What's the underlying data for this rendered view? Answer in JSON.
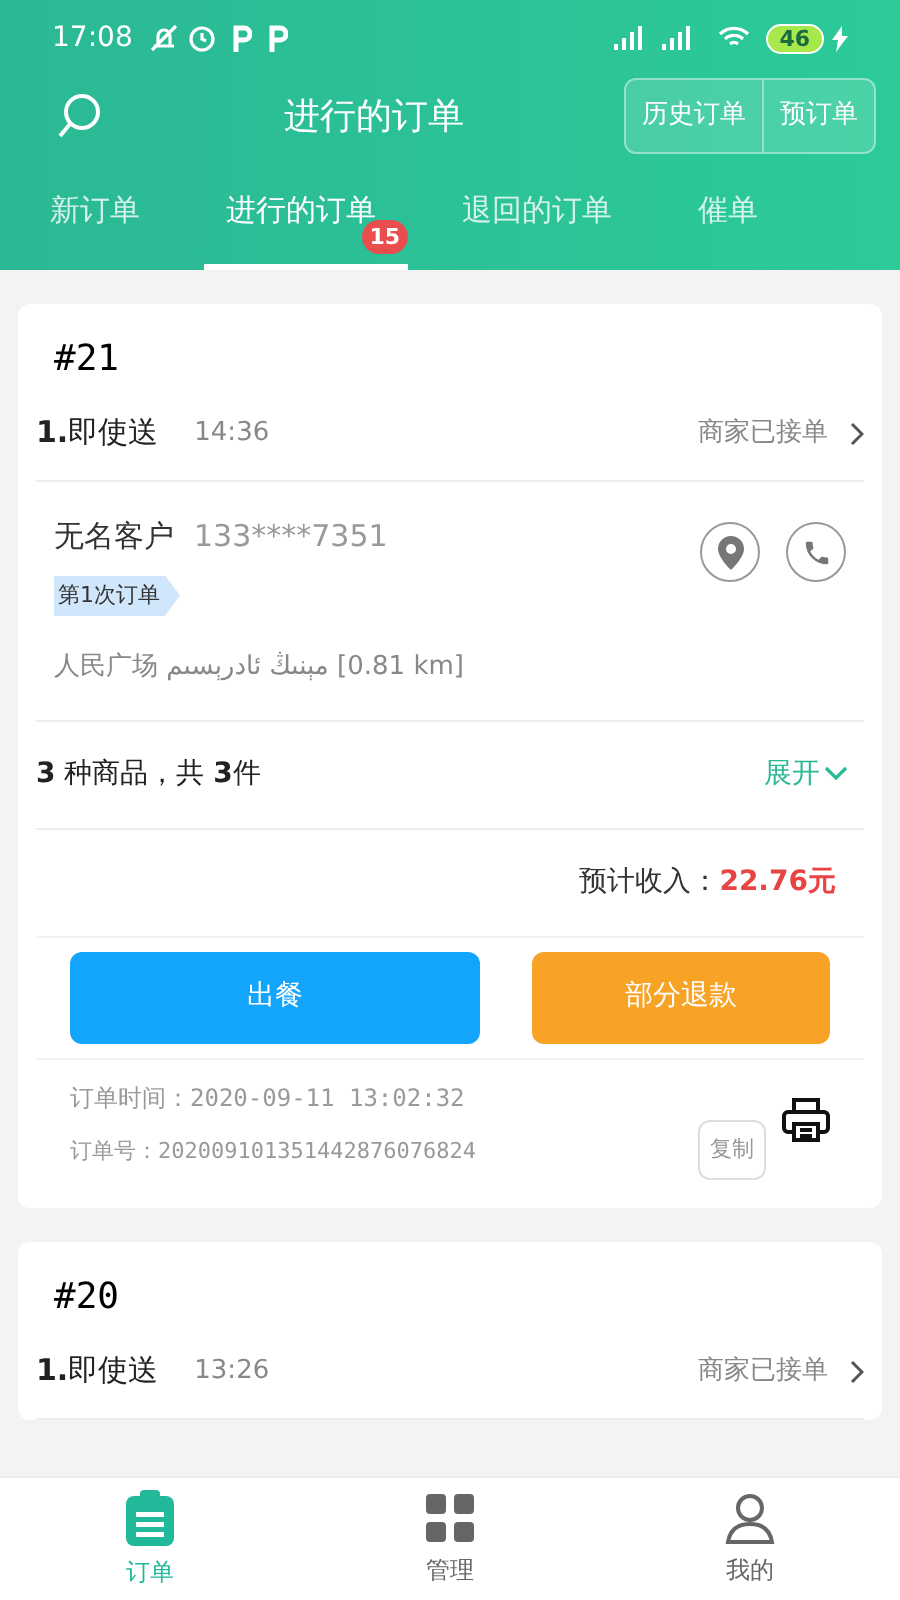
{
  "status_bar": {
    "time": "17:08",
    "battery": "46"
  },
  "header": {
    "title": "进行的订单",
    "buttons": [
      "历史订单",
      "预订单"
    ]
  },
  "tabs": [
    {
      "label": "新订单",
      "selected": false
    },
    {
      "label": "进行的订单",
      "selected": true,
      "badge": "15"
    },
    {
      "label": "退回的订单",
      "selected": false
    },
    {
      "label": "催单",
      "selected": false
    }
  ],
  "orders": [
    {
      "number": "#21",
      "delivery": "**1.**即使送",
      "time": "14:36",
      "status": "商家已接单",
      "expanded": true,
      "customer": "无名客户",
      "phone": "133****7351",
      "tag": "第1次订单",
      "address": "人民广场 مېنىڭ ئادرېسىم [0.81 km]",
      "items": "**3** 种商品，共 **3**件",
      "expand_label": "展开",
      "income_label": "预计收入：",
      "income": "22.76元",
      "actions": [
        "出餐",
        "部分退款"
      ],
      "order_time": "订单时间：2020-09-11 13:02:32",
      "order_no": "订单号：202009101351442876076824",
      "copy": "复制"
    },
    {
      "number": "#20",
      "delivery": "**1.**即使送",
      "time": "13:26",
      "status": "商家已接单",
      "expanded": false
    }
  ],
  "bottom_nav": [
    {
      "label": "订单",
      "selected": true,
      "kind": "orders"
    },
    {
      "label": "管理",
      "selected": false,
      "kind": "manage"
    },
    {
      "label": "我的",
      "selected": false,
      "kind": "me"
    }
  ]
}
